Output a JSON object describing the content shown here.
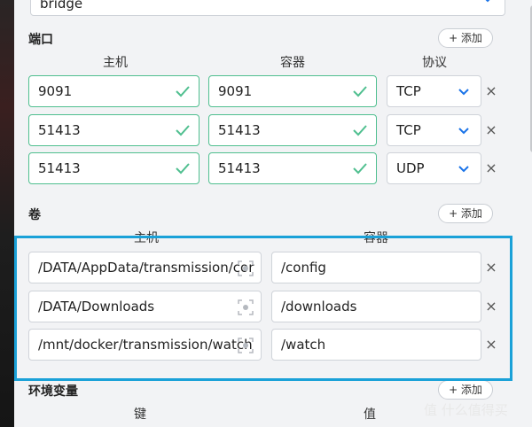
{
  "network": {
    "value": "bridge"
  },
  "ports": {
    "title": "端口",
    "add_label": "+ 添加",
    "col_host": "主机",
    "col_container": "容器",
    "col_protocol": "协议",
    "rows": [
      {
        "host": "9091",
        "container": "9091",
        "protocol": "TCP"
      },
      {
        "host": "51413",
        "container": "51413",
        "protocol": "TCP"
      },
      {
        "host": "51413",
        "container": "51413",
        "protocol": "UDP"
      }
    ]
  },
  "volumes": {
    "title": "卷",
    "add_label": "+ 添加",
    "col_host": "主机",
    "col_container": "容器",
    "rows": [
      {
        "host": "/DATA/AppData/transmission/cor",
        "container": "/config"
      },
      {
        "host": "/DATA/Downloads",
        "container": "/downloads"
      },
      {
        "host": "/mnt/docker/transmission/watch",
        "container": "/watch"
      }
    ]
  },
  "env": {
    "title": "环境变量",
    "add_label": "+ 添加",
    "col_key": "键",
    "col_value": "值"
  },
  "remove_glyph": "×",
  "watermark": "值 什么值得买",
  "colors": {
    "accent": "#1a73e8",
    "ok": "#4fbf8f",
    "highlight": "#1aa1d8"
  }
}
